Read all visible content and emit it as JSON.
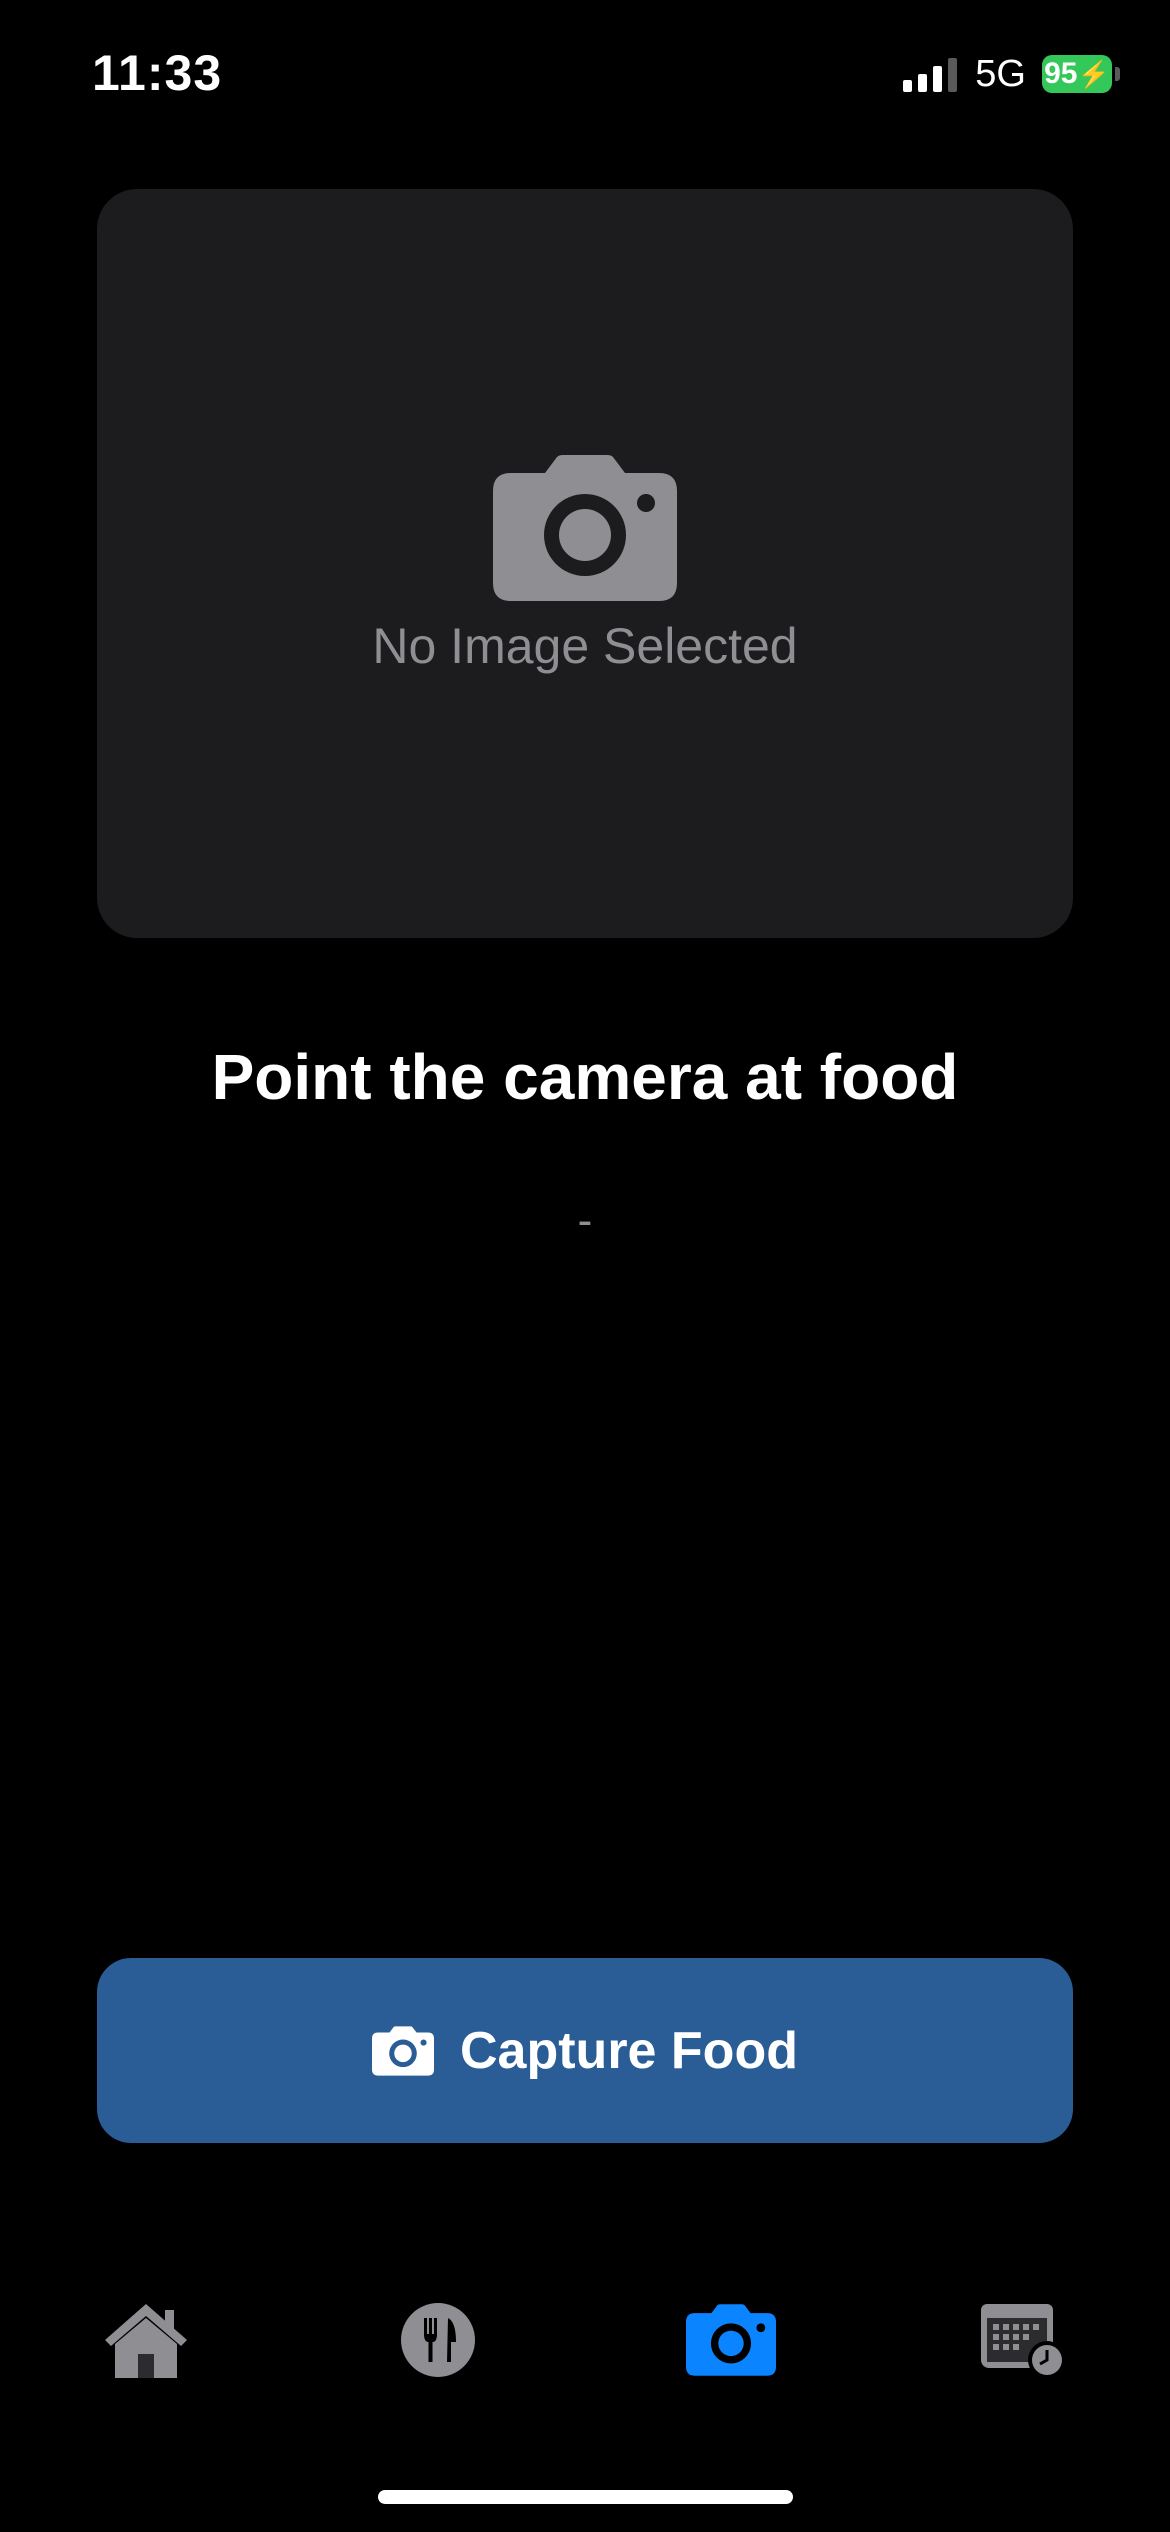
{
  "status_bar": {
    "time": "11:33",
    "network": "5G",
    "battery": "95"
  },
  "preview": {
    "placeholder_icon": "camera-icon",
    "placeholder_text": "No Image Selected"
  },
  "headline": "Point the camera at food",
  "result_text": "-",
  "capture_button": {
    "icon": "camera-icon",
    "label": "Capture Food",
    "color": "#2a5d96"
  },
  "tab_bar": {
    "active_tab": "camera",
    "active_color": "#0a84ff",
    "inactive_color": "#8e8e93",
    "tabs": [
      {
        "id": "home",
        "icon": "house-icon"
      },
      {
        "id": "meals",
        "icon": "fork-knife-icon"
      },
      {
        "id": "camera",
        "icon": "camera-icon"
      },
      {
        "id": "history",
        "icon": "calendar-clock-icon"
      }
    ]
  },
  "colors": {
    "background": "#000000",
    "card": "#1c1c1e",
    "battery": "#34c759"
  }
}
